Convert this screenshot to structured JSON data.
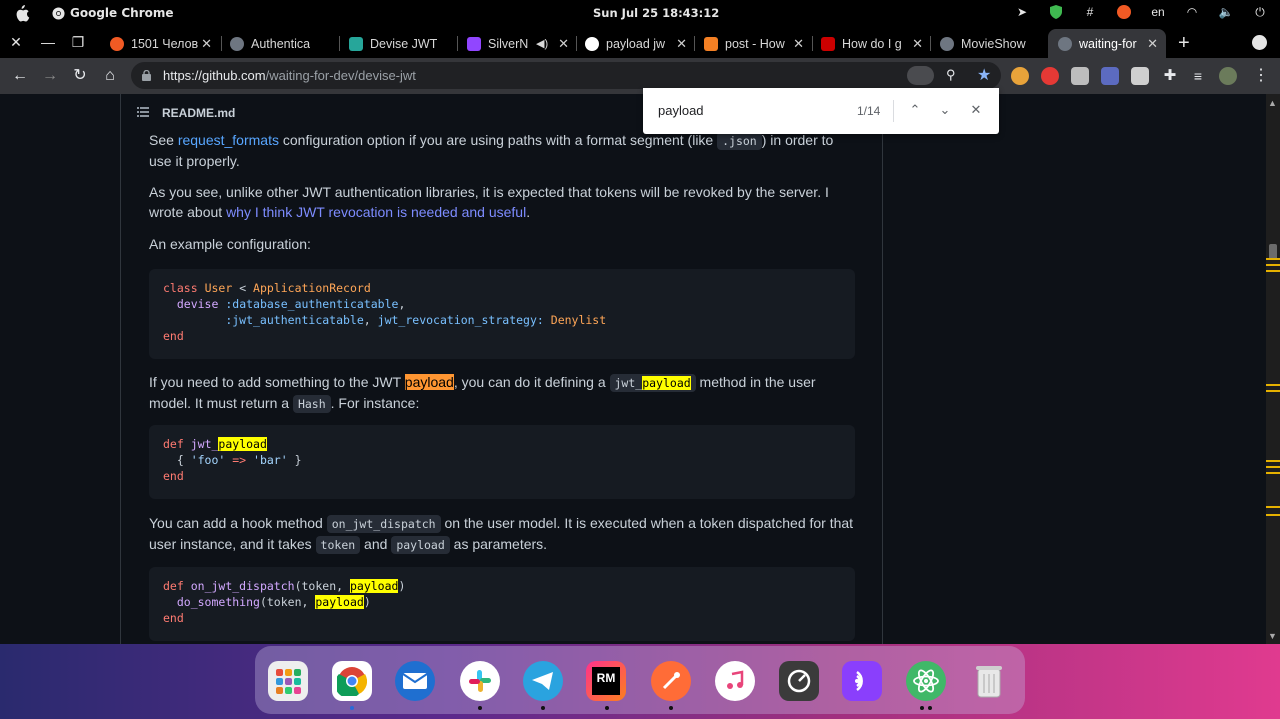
{
  "system_bar": {
    "app_name": "Google Chrome",
    "clock": "Sun Jul 25  18:43:12",
    "language": "en"
  },
  "tabs": [
    {
      "title": "1501 Челов",
      "favicon_color": "#f15a24"
    },
    {
      "title": "Authentica",
      "favicon_color": "#6e7681"
    },
    {
      "title": "Devise JWT",
      "favicon_color": "#26a69a"
    },
    {
      "title": "SilverN",
      "favicon_color": "#9146ff"
    },
    {
      "title": "payload jw",
      "favicon_color": "#ffffff"
    },
    {
      "title": "post - How",
      "favicon_color": "#f48024"
    },
    {
      "title": "How do I g",
      "favicon_color": "#cc0000"
    },
    {
      "title": "MovieShow",
      "favicon_color": "#6e7681"
    },
    {
      "title": "waiting-for",
      "favicon_color": "#6e7681",
      "active": true
    }
  ],
  "omnibox": {
    "host": "https://github.com",
    "path": "/waiting-for-dev/devise-jwt"
  },
  "find_bar": {
    "query": "payload",
    "count": "1/14"
  },
  "readme": {
    "filename": "README.md",
    "p1": {
      "pre": "See ",
      "link": "request_formats",
      "mid": " configuration option if you are using paths with a format segment (like ",
      "code": ".json",
      "post": ") in order to use it properly."
    },
    "p2": {
      "pre": "As you see, unlike other JWT authentication libraries, it is expected that tokens will be revoked by the server. I wrote about ",
      "link": "why I think JWT revocation is needed and useful",
      "post": "."
    },
    "p3": "An example configuration:",
    "p4": {
      "a": "If you need to add something to the JWT ",
      "hl": "payload",
      "b": ", you can do it defining a ",
      "code_a": "jwt_",
      "code_hl": "payload",
      "c": " method in the user model. It must return a ",
      "code2": "Hash",
      "d": ". For instance:"
    },
    "p5": {
      "a": "You can add a hook method ",
      "code1": "on_jwt_dispatch",
      "b": " on the user model. It is executed when a token dispatched for that user instance, and it takes ",
      "code2": "token",
      "c": " and ",
      "code3": "payload",
      "d": " as parameters."
    },
    "code1": {
      "l1_kw": "class",
      "l1_cls": "User",
      "l1_op": " < ",
      "l1_base": "ApplicationRecord",
      "l2_fn": "devise",
      "l2_sym": ":database_authenticatable",
      "l3_sym1": ":jwt_authenticatable",
      "l3_key": "jwt_revocation_strategy:",
      "l3_cls": "Denylist",
      "l4": "end"
    },
    "code2": {
      "l1_kw": "def",
      "l1_fn": "jwt_",
      "l1_hl": "payload",
      "l2_str1": "'foo'",
      "l2_op": " => ",
      "l2_str2": "'bar'",
      "l3": "end"
    },
    "code3": {
      "l1_kw": "def",
      "l1_fn": "on_jwt_dispatch",
      "l1_args": "(token, ",
      "l1_hl": "payload",
      "l1_close": ")",
      "l2_fn": "do_something",
      "l2_args": "(token, ",
      "l2_hl": "payload",
      "l2_close": ")",
      "l3": "end"
    }
  },
  "dock": {
    "apps": [
      {
        "name": "launcher",
        "color": "#f0f0f0"
      },
      {
        "name": "chrome",
        "color": "#ffffff"
      },
      {
        "name": "thunderbird",
        "color": "#1f6fd0"
      },
      {
        "name": "slack",
        "color": "#ffffff"
      },
      {
        "name": "telegram",
        "color": "#2aa3df"
      },
      {
        "name": "rubymine",
        "color": "#e0245e"
      },
      {
        "name": "postman",
        "color": "#ff6c37"
      },
      {
        "name": "itunes",
        "color": "#ffffff"
      },
      {
        "name": "timer",
        "color": "#333333"
      },
      {
        "name": "podcast",
        "color": "#8a3ffc"
      },
      {
        "name": "atom",
        "color": "#40b868"
      },
      {
        "name": "trash",
        "color": "#d0d0d0"
      }
    ]
  }
}
